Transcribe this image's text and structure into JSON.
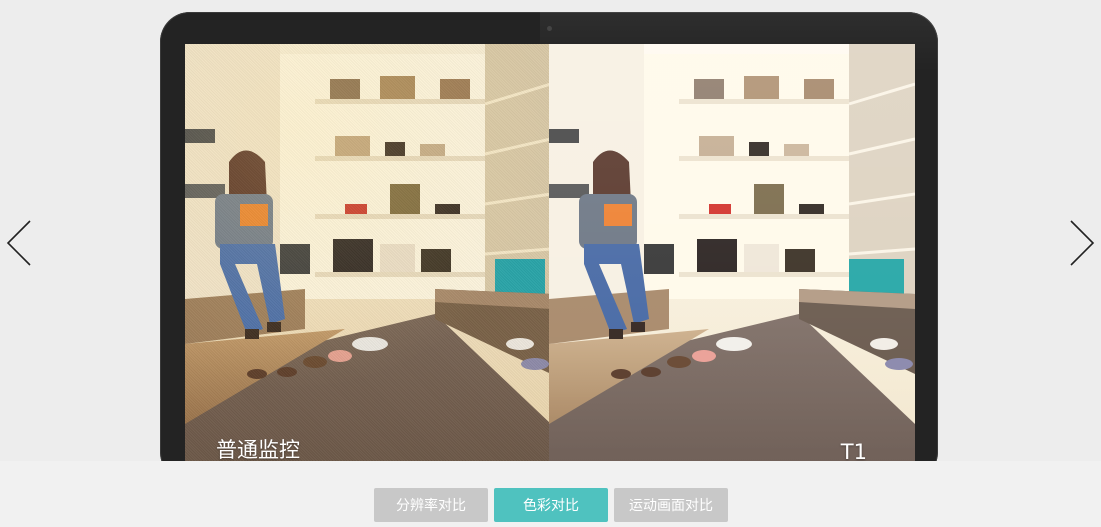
{
  "panels": {
    "left_label": "普通监控",
    "right_label": "T1"
  },
  "tabs": [
    {
      "label": "分辨率对比",
      "active": false
    },
    {
      "label": "色彩对比",
      "active": true
    },
    {
      "label": "运动画面对比",
      "active": false
    }
  ],
  "icons": {
    "prev": "chevron-left-icon",
    "next": "chevron-right-icon"
  },
  "colors": {
    "active_tab": "#4fc2bf",
    "inactive_tab": "#c8c8c8",
    "monitor_frame": "#232323",
    "background": "#ededed"
  }
}
